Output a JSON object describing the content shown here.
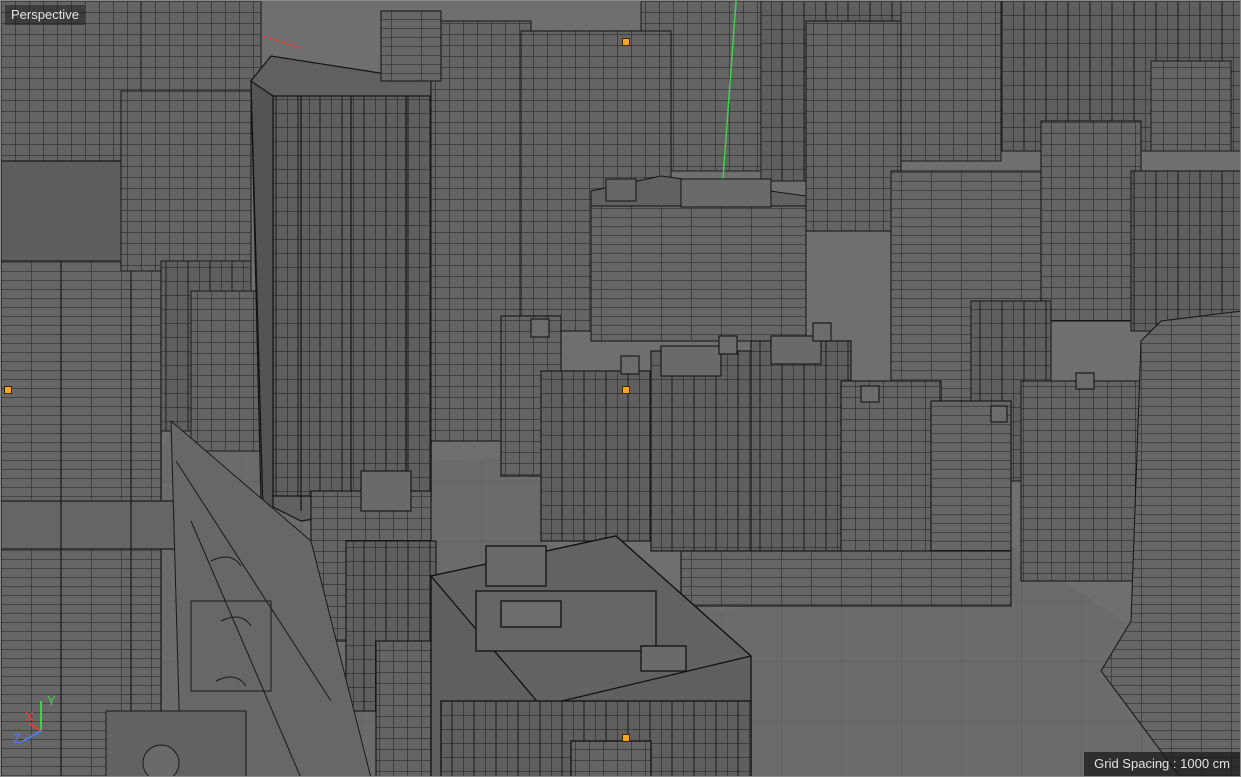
{
  "viewport": {
    "label": "Perspective",
    "grid_spacing_text": "Grid Spacing : 1000 cm"
  },
  "axis_gizmo": {
    "y_label": "Y",
    "x_label": "X",
    "z_label": "Z",
    "icon": "axis-gizmo-icon"
  },
  "colors": {
    "viewport_bg": "#6e6e6e",
    "building_fill": "#636363",
    "wire": "#1c1c1c",
    "y_axis": "#3fd24a",
    "x_axis": "#e0413a",
    "z_axis": "#4a7df0",
    "handle": "#f5a623"
  }
}
